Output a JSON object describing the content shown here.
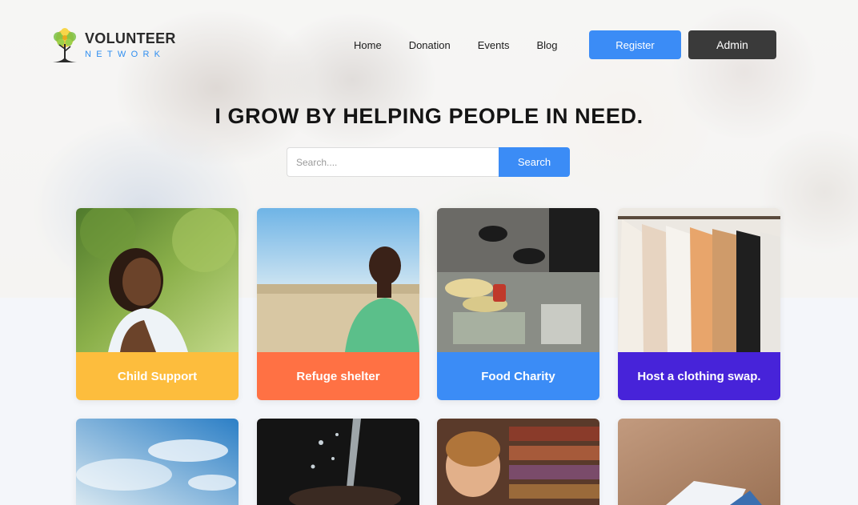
{
  "brand": {
    "name": "VOLUNTEER",
    "tagline": "NETWORK",
    "icon": "tree-logo-icon",
    "colors": {
      "title": "#2b2b2b",
      "tagline": "#2f8ef0",
      "foliage": "#f2c230",
      "foliage_alt": "#7ac143"
    }
  },
  "nav": {
    "items": [
      {
        "label": "Home"
      },
      {
        "label": "Donation"
      },
      {
        "label": "Events"
      },
      {
        "label": "Blog"
      }
    ]
  },
  "actions": {
    "register_label": "Register",
    "admin_label": "Admin"
  },
  "hero": {
    "headline": "I GROW BY HELPING PEOPLE IN NEED."
  },
  "search": {
    "placeholder": "Search....",
    "value": "",
    "button_label": "Search"
  },
  "cards": [
    {
      "title": "Child Support",
      "color": "#fdbd3d",
      "image": "girl-smiling-photo"
    },
    {
      "title": "Refuge shelter",
      "color": "#ff7144",
      "image": "boy-in-field-photo"
    },
    {
      "title": "Food Charity",
      "color": "#3b8cf6",
      "image": "food-distribution-photo"
    },
    {
      "title": "Host a clothing swap.",
      "color": "#4723d9",
      "image": "clothing-rack-photo"
    },
    {
      "title": "",
      "color": "",
      "image": "blue-sky-clouds-photo"
    },
    {
      "title": "",
      "color": "",
      "image": "water-hands-photo"
    },
    {
      "title": "",
      "color": "",
      "image": "child-library-photo"
    },
    {
      "title": "",
      "color": "",
      "image": "reading-book-photo"
    }
  ],
  "colors": {
    "accent": "#3b8cf6",
    "dark_button": "#3a3a3a",
    "page_background": "#f4f6fa"
  }
}
